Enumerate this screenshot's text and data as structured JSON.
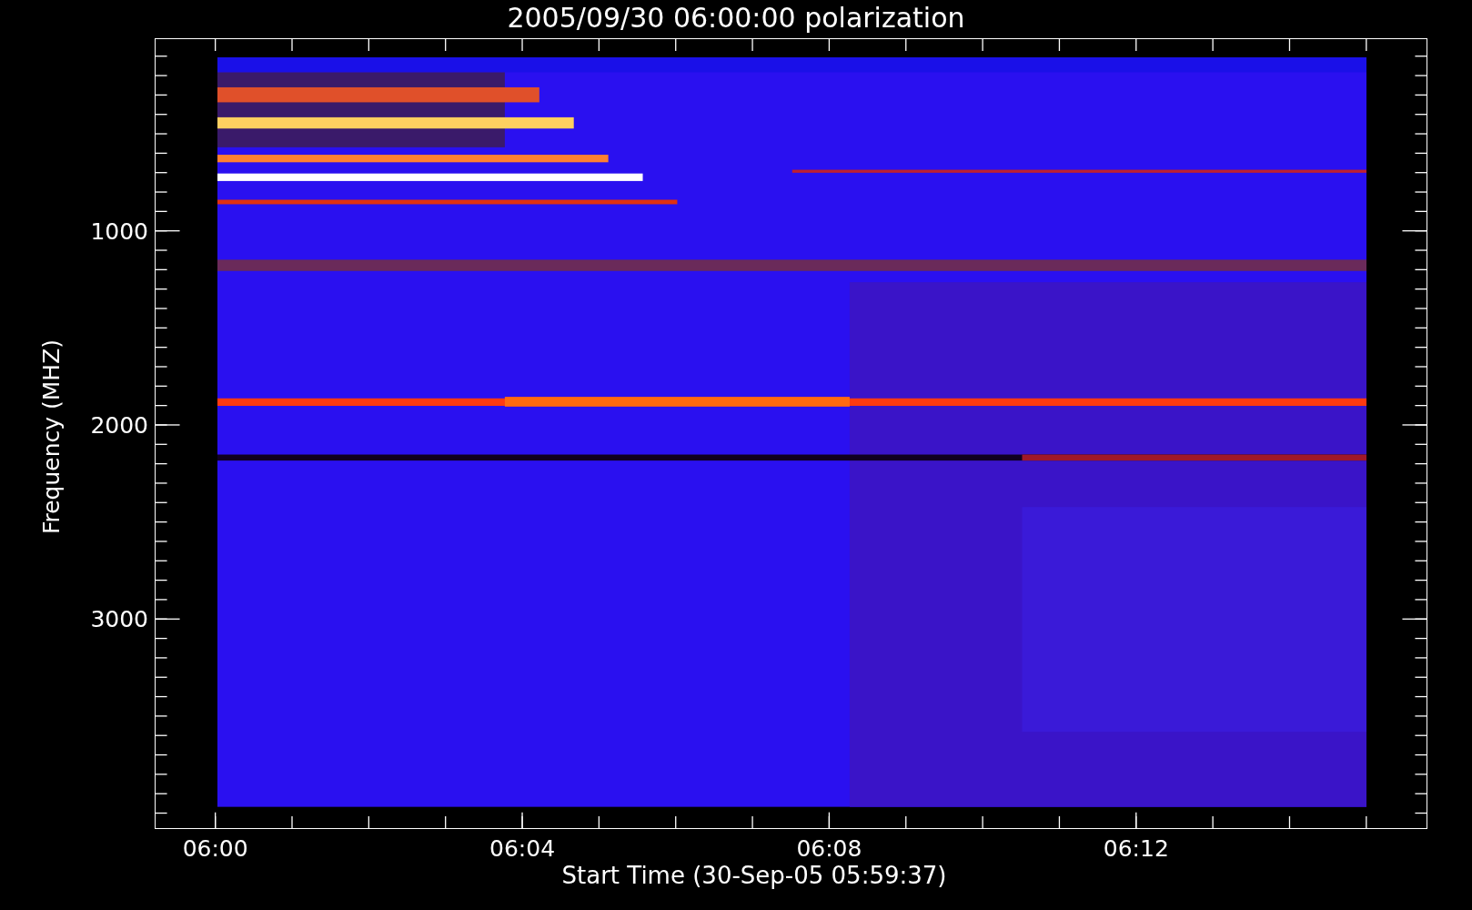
{
  "title": "2005/09/30 06:00:00 polarization",
  "y_axis": {
    "label": "Frequency (MHZ)",
    "ticks": [
      "1000",
      "2000",
      "3000"
    ]
  },
  "x_axis": {
    "label": "Start Time (30-Sep-05 05:59:37)",
    "ticks": [
      "06:00",
      "06:04",
      "06:08",
      "06:12"
    ]
  }
}
